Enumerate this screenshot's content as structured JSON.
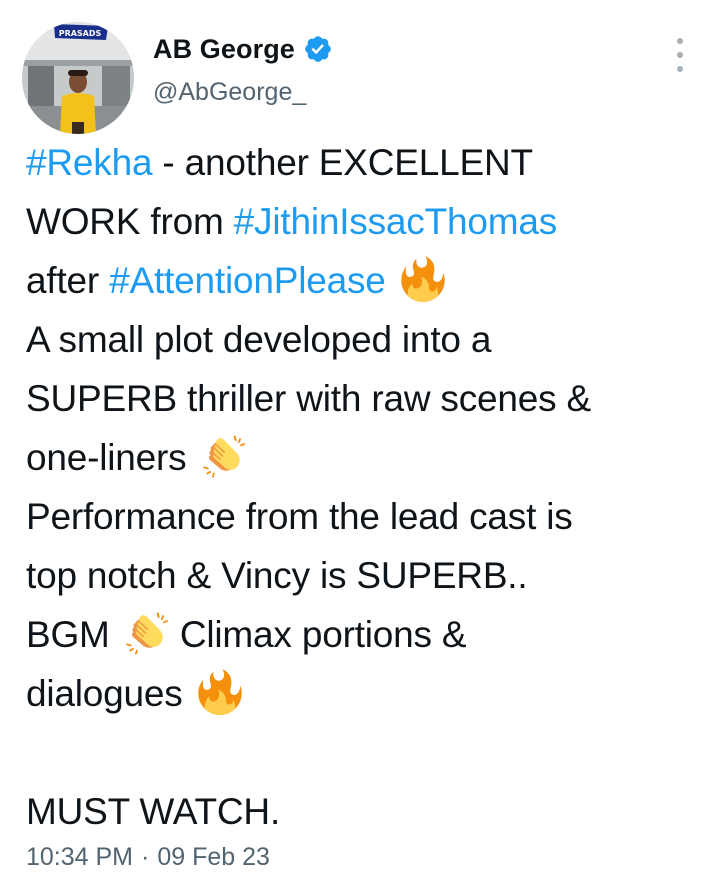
{
  "author": {
    "display_name": "AB George",
    "handle": "@AbGeorge_",
    "avatar_sign_text": "PRASADS"
  },
  "tweet": {
    "hashtag_rekha": "#Rekha",
    "line1_rest": " - another EXCELLENT",
    "line2_start": "WORK from ",
    "hashtag_jithin": "#JithinIssacThomas",
    "line3_start": "after ",
    "hashtag_attention": "#AttentionPlease",
    "line4": "A small plot developed into a",
    "line5": "SUPERB thriller with raw scenes &",
    "line6": "one-liners",
    "line7": "Performance from the lead cast is",
    "line8": "top notch & Vincy is SUPERB..",
    "line9_a": "BGM",
    "line9_b": "Climax portions &",
    "line10": "dialogues",
    "line11": "MUST WATCH."
  },
  "meta": {
    "time": "10:34 PM",
    "separator": "·",
    "date": "09 Feb 23"
  },
  "colors": {
    "hashtag": "#1d9bf0",
    "secondary_text": "#536471",
    "verified_badge": "#1d9bf0"
  },
  "icons": {
    "verified": "verified-badge-icon",
    "more": "more-options-icon",
    "fire": "fire-emoji",
    "clap": "clapping-hands-emoji"
  }
}
